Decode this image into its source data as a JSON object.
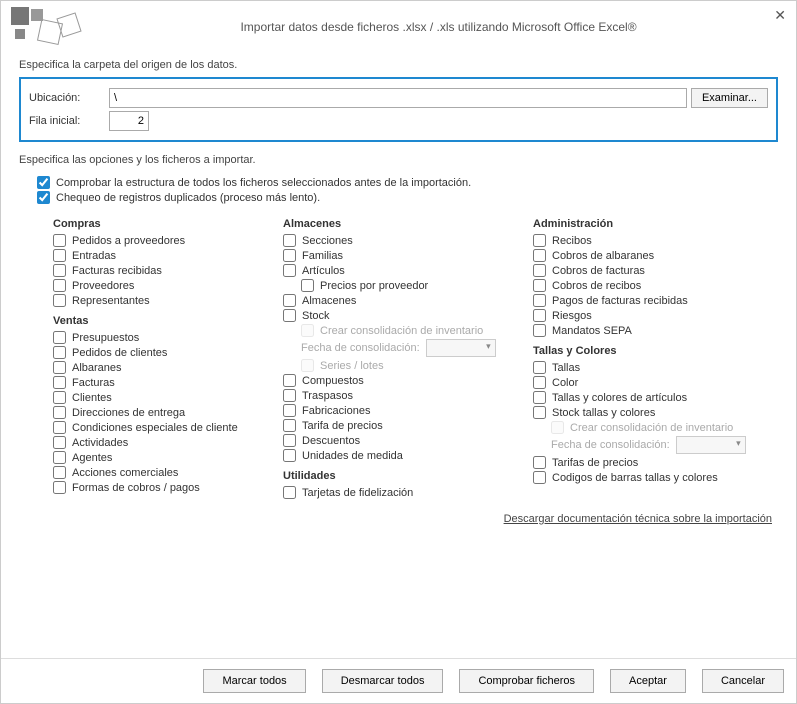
{
  "title": "Importar datos desde ficheros .xlsx / .xls utilizando Microsoft Office Excel®",
  "labels": {
    "section1": "Especifica la carpeta del origen de los datos.",
    "ubicacion": "Ubicación:",
    "ubicacion_value": "\\",
    "fila": "Fila inicial:",
    "fila_value": "2",
    "examinar": "Examinar...",
    "section2": "Especifica las opciones y los ficheros a importar.",
    "ck_structure": "Comprobar la estructura de todos los ficheros seleccionados antes de la importación.",
    "ck_duplicates": "Chequeo de registros duplicados (proceso más lento).",
    "link": "Descargar documentación técnica sobre la importación"
  },
  "groups": {
    "compras": {
      "title": "Compras",
      "items": [
        "Pedidos a proveedores",
        "Entradas",
        "Facturas recibidas",
        "Proveedores",
        "Representantes"
      ]
    },
    "ventas": {
      "title": "Ventas",
      "items": [
        "Presupuestos",
        "Pedidos de clientes",
        "Albaranes",
        "Facturas",
        "Clientes",
        "Direcciones de entrega",
        "Condiciones especiales de cliente",
        "Actividades",
        "Agentes",
        "Acciones comerciales",
        "Formas de cobros / pagos"
      ]
    },
    "almacenes": {
      "title": "Almacenes",
      "items_top": [
        "Secciones",
        "Familias",
        "Artículos"
      ],
      "precios": "Precios por proveedor",
      "items_mid": [
        "Almacenes",
        "Stock"
      ],
      "crear_consol": "Crear consolidación de inventario",
      "fecha_consol": "Fecha de consolidación:",
      "series": "Series / lotes",
      "items_bot": [
        "Compuestos",
        "Traspasos",
        "Fabricaciones",
        "Tarifa de precios",
        "Descuentos",
        "Unidades de medida"
      ]
    },
    "utilidades": {
      "title": "Utilidades",
      "items": [
        "Tarjetas de fidelización"
      ]
    },
    "administracion": {
      "title": "Administración",
      "items": [
        "Recibos",
        "Cobros de albaranes",
        "Cobros de facturas",
        "Cobros de recibos",
        "Pagos de facturas recibidas",
        "Riesgos",
        "Mandatos SEPA"
      ]
    },
    "tallas": {
      "title": "Tallas y Colores",
      "items_top": [
        "Tallas",
        "Color",
        "Tallas y colores de artículos",
        "Stock tallas y colores"
      ],
      "crear_consol": "Crear consolidación de inventario",
      "fecha_consol": "Fecha de consolidación:",
      "items_bot": [
        "Tarifas de precios",
        "Codigos de barras tallas y colores"
      ]
    }
  },
  "buttons": {
    "marcar": "Marcar todos",
    "desmarcar": "Desmarcar todos",
    "comprobar": "Comprobar ficheros",
    "aceptar": "Aceptar",
    "cancelar": "Cancelar"
  }
}
